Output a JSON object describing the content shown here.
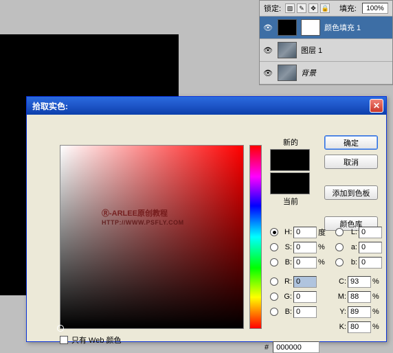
{
  "layers_panel": {
    "lock_label": "锁定:",
    "fill_label": "填充:",
    "fill_value": "100%",
    "layers": [
      {
        "name": "颜色填充 1",
        "selected": true,
        "thumb": "black",
        "mask": true
      },
      {
        "name": "图层 1",
        "selected": false,
        "thumb": "img"
      },
      {
        "name": "背景",
        "selected": false,
        "thumb": "img",
        "italic": true
      }
    ]
  },
  "dialog": {
    "title": "拾取实色:",
    "new_label": "新的",
    "current_label": "当前",
    "buttons": {
      "ok": "确定",
      "cancel": "取消",
      "add_swatch": "添加到色板",
      "color_lib": "颜色库"
    },
    "fields": {
      "H": {
        "label": "H:",
        "value": "0",
        "unit": "度"
      },
      "S": {
        "label": "S:",
        "value": "0",
        "unit": "%"
      },
      "Bv": {
        "label": "B:",
        "value": "0",
        "unit": "%"
      },
      "R": {
        "label": "R:",
        "value": "0",
        "unit": ""
      },
      "G": {
        "label": "G:",
        "value": "0",
        "unit": ""
      },
      "Bb": {
        "label": "B:",
        "value": "0",
        "unit": ""
      },
      "L": {
        "label": "L:",
        "value": "0",
        "unit": ""
      },
      "a": {
        "label": "a:",
        "value": "0",
        "unit": ""
      },
      "b": {
        "label": "b:",
        "value": "0",
        "unit": ""
      },
      "C": {
        "label": "C:",
        "value": "93",
        "unit": "%"
      },
      "M": {
        "label": "M:",
        "value": "88",
        "unit": "%"
      },
      "Y": {
        "label": "Y:",
        "value": "89",
        "unit": "%"
      },
      "K": {
        "label": "K:",
        "value": "80",
        "unit": "%"
      }
    },
    "hex_label": "#",
    "hex_value": "000000",
    "web_only": "只有 Web 颜色",
    "watermark": "Ⓡ-ARLEE原创教程",
    "watermark_url": "HTTP://WWW.PSFLY.COM"
  }
}
